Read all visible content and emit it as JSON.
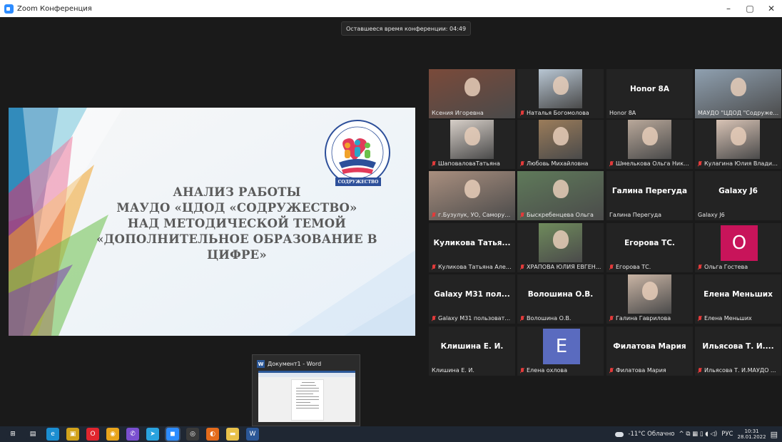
{
  "window": {
    "title": "Zoom Конференция",
    "minimize": "–",
    "maximize": "▢",
    "close": "✕"
  },
  "meeting": {
    "time_left": "Оставшееся время конференции: 04:49"
  },
  "slide": {
    "lines": [
      "АНАЛИЗ РАБОТЫ",
      "МАУДО «ЦДОД «СОДРУЖЕСТВО»",
      "НАД МЕТОДИЧЕСКОЙ ТЕМОЙ",
      "«ДОПОЛНИТЕЛЬНОЕ ОБРАЗОВАНИЕ В",
      "ЦИФРЕ»"
    ],
    "logo_text": "СОДРУЖЕСТВО"
  },
  "participants": [
    {
      "name": "Ксения Игоревна",
      "muted": false,
      "kind": "video",
      "color": "#7a4a3a"
    },
    {
      "name": "Наталья Богомолова",
      "muted": true,
      "kind": "video",
      "color": "#b8c6d3"
    },
    {
      "name": "Honor 8A",
      "muted": false,
      "kind": "text",
      "label": "Honor 8A"
    },
    {
      "name": "МАУДО \"ЦДОД \"Содружество\"",
      "muted": false,
      "kind": "video",
      "color": "#8fa0b0",
      "active": true
    },
    {
      "name": "ШаповаловаТатьяна",
      "muted": true,
      "kind": "video",
      "color": "#d7cfc8"
    },
    {
      "name": "Любовь Михайловна",
      "muted": true,
      "kind": "video",
      "color": "#9b7c5a"
    },
    {
      "name": "Шмелькова Ольга Ник...",
      "muted": true,
      "kind": "video",
      "color": "#b9a89a"
    },
    {
      "name": "Кулагина Юлия Владим...",
      "muted": true,
      "kind": "video",
      "color": "#d8c3b5"
    },
    {
      "name": "г.Бузулук, УО, Саморук...",
      "muted": true,
      "kind": "video",
      "color": "#a98f7f"
    },
    {
      "name": "Быскребенцева Ольга",
      "muted": true,
      "kind": "video",
      "color": "#5f7a5a"
    },
    {
      "name": "Галина Перегуда",
      "muted": false,
      "kind": "text",
      "label": "Галина Перегуда"
    },
    {
      "name": "Galaxy J6",
      "muted": false,
      "kind": "text",
      "label": "Galaxy J6"
    },
    {
      "name": "Куликова Татьяна Алек...",
      "muted": true,
      "kind": "text",
      "label": "Куликова Татья..."
    },
    {
      "name": "ХРАПОВА ЮЛИЯ ЕВГЕН...",
      "muted": true,
      "kind": "video",
      "color": "#6f8b5c"
    },
    {
      "name": "Егорова ТС.",
      "muted": true,
      "kind": "text",
      "label": "Егорова ТС."
    },
    {
      "name": "Ольга Гостева",
      "muted": true,
      "kind": "letter",
      "letter": "О",
      "color": "#c8145a"
    },
    {
      "name": "Galaxy M31 пользовате...",
      "muted": true,
      "kind": "text",
      "label": "Galaxy M31 пол..."
    },
    {
      "name": "Волошина О.В.",
      "muted": true,
      "kind": "text",
      "label": "Волошина О.В."
    },
    {
      "name": "Галина Гаврилова",
      "muted": true,
      "kind": "video",
      "color": "#c9b4a4"
    },
    {
      "name": "Елена Меньших",
      "muted": true,
      "kind": "text",
      "label": "Елена Меньших"
    },
    {
      "name": "Клишина Е. И.",
      "muted": false,
      "kind": "text",
      "label": "Клишина Е. И."
    },
    {
      "name": "Елена охлова",
      "muted": true,
      "kind": "letter",
      "letter": "Е",
      "color": "#5a6bbf"
    },
    {
      "name": "Филатова Мария",
      "muted": true,
      "kind": "text",
      "label": "Филатова Мария"
    },
    {
      "name": "Ильясова Т. И.МАУДО ...",
      "muted": true,
      "kind": "text",
      "label": "Ильясова Т. И...."
    }
  ],
  "thumbnail": {
    "title": "Документ1 - Word",
    "icon": "W"
  },
  "taskbar": {
    "apps": [
      {
        "icon": "windows-icon",
        "glyph": "⊞",
        "color": "#1f2733"
      },
      {
        "icon": "task-view-icon",
        "glyph": "▤",
        "color": "#1f2733"
      },
      {
        "icon": "edge-icon",
        "glyph": "e",
        "color": "#1b8ed1"
      },
      {
        "icon": "store-icon",
        "glyph": "▣",
        "color": "#d1a21b"
      },
      {
        "icon": "opera-icon",
        "glyph": "O",
        "color": "#e0262e"
      },
      {
        "icon": "chrome-icon",
        "glyph": "◉",
        "color": "#e8a41c"
      },
      {
        "icon": "viber-icon",
        "glyph": "✆",
        "color": "#7a4fd0"
      },
      {
        "icon": "telegram-icon",
        "glyph": "➤",
        "color": "#2aa3df"
      },
      {
        "icon": "zoom-icon",
        "glyph": "◼",
        "color": "#2d8cff"
      },
      {
        "icon": "obs-icon",
        "glyph": "◎",
        "color": "#3a3a3a"
      },
      {
        "icon": "firefox-icon",
        "glyph": "◐",
        "color": "#e36b1c"
      },
      {
        "icon": "explorer-icon",
        "glyph": "▬",
        "color": "#e8c14a"
      },
      {
        "icon": "word-icon",
        "glyph": "W",
        "color": "#2b5797"
      }
    ],
    "weather": "-11°C Облачно",
    "tray_icons": "^ ⧉ ▦ ▯ ◖ ◁)",
    "language": "РУС",
    "time": "10:31",
    "date": "28.01.2022",
    "notifications": "▤"
  }
}
